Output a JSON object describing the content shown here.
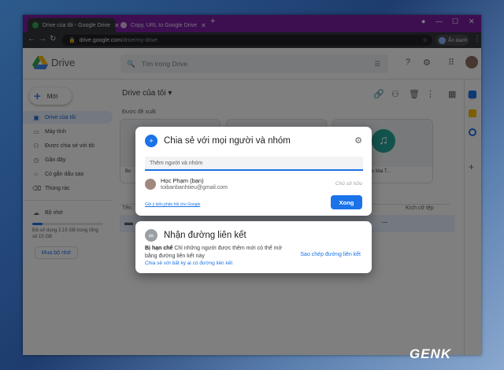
{
  "browser": {
    "tabs": [
      {
        "label": "Drive của tôi - Google Drive"
      },
      {
        "label": "Copy, URL to Google Drive"
      }
    ],
    "new_tab": "+",
    "url_domain": "drive.google.com",
    "url_path": "/drive/my-drive",
    "incognito_label": "Ẩn danh",
    "win_min": "—",
    "win_max": "☐",
    "win_close": "✕"
  },
  "header": {
    "app_name": "Drive",
    "search_placeholder": "Tìm trong Drive"
  },
  "sidebar": {
    "new_label": "Mới",
    "items": [
      {
        "label": "Drive của tôi",
        "icon": "drive-icon",
        "glyph": "▣"
      },
      {
        "label": "Máy tính",
        "icon": "computer-icon",
        "glyph": "▭"
      },
      {
        "label": "Được chia sẻ với tôi",
        "icon": "shared-icon",
        "glyph": "👥"
      },
      {
        "label": "Gần đây",
        "icon": "clock-icon",
        "glyph": "◷"
      },
      {
        "label": "Có gắn dấu sao",
        "icon": "star-icon",
        "glyph": "☆"
      },
      {
        "label": "Thùng rác",
        "icon": "trash-icon",
        "glyph": "🗑"
      }
    ],
    "storage_label": "Bộ nhớ",
    "storage_text": "Đã sử dụng 2,15 GB trong tổng số 15 GB",
    "storage_fraction": 0.143,
    "buy_label": "Mua bộ nhớ"
  },
  "main": {
    "breadcrumb": "Drive của tôi",
    "suggested_label": "Được đề xuất",
    "card_captions": [
      "Bo",
      "",
      "nei"
    ],
    "card_right_title": "Ven Duong - Ngo Mai T...",
    "col_name": "Tên",
    "col_size": "Kích cỡ tệp",
    "row_size": "—"
  },
  "share_dialog": {
    "title": "Chia sẻ với mọi người và nhóm",
    "input_placeholder": "Thêm người và nhóm",
    "person_name": "Học Phạm (bạn)",
    "person_email": "toibanbanhtieu@gmail.com",
    "person_role": "Chủ sở hữu",
    "feedback_link": "Gửi ý kiến phản hồi cho Google",
    "done_button": "Xong"
  },
  "link_dialog": {
    "title": "Nhận đường liên kết",
    "restriction_bold": "Bị hạn chế",
    "restriction_text": " Chỉ những người được thêm mới có thể mở bằng đường liên kết này",
    "change_link": "Chia sẻ với bất kỳ ai có đường liên kết",
    "copy_link": "Sao chép đường liên kết"
  },
  "watermark": "GENK",
  "colors": {
    "tabbar": "#7b1fa2",
    "accent": "#1a73e8",
    "overlay": "rgba(0,0,0,0.5)"
  }
}
